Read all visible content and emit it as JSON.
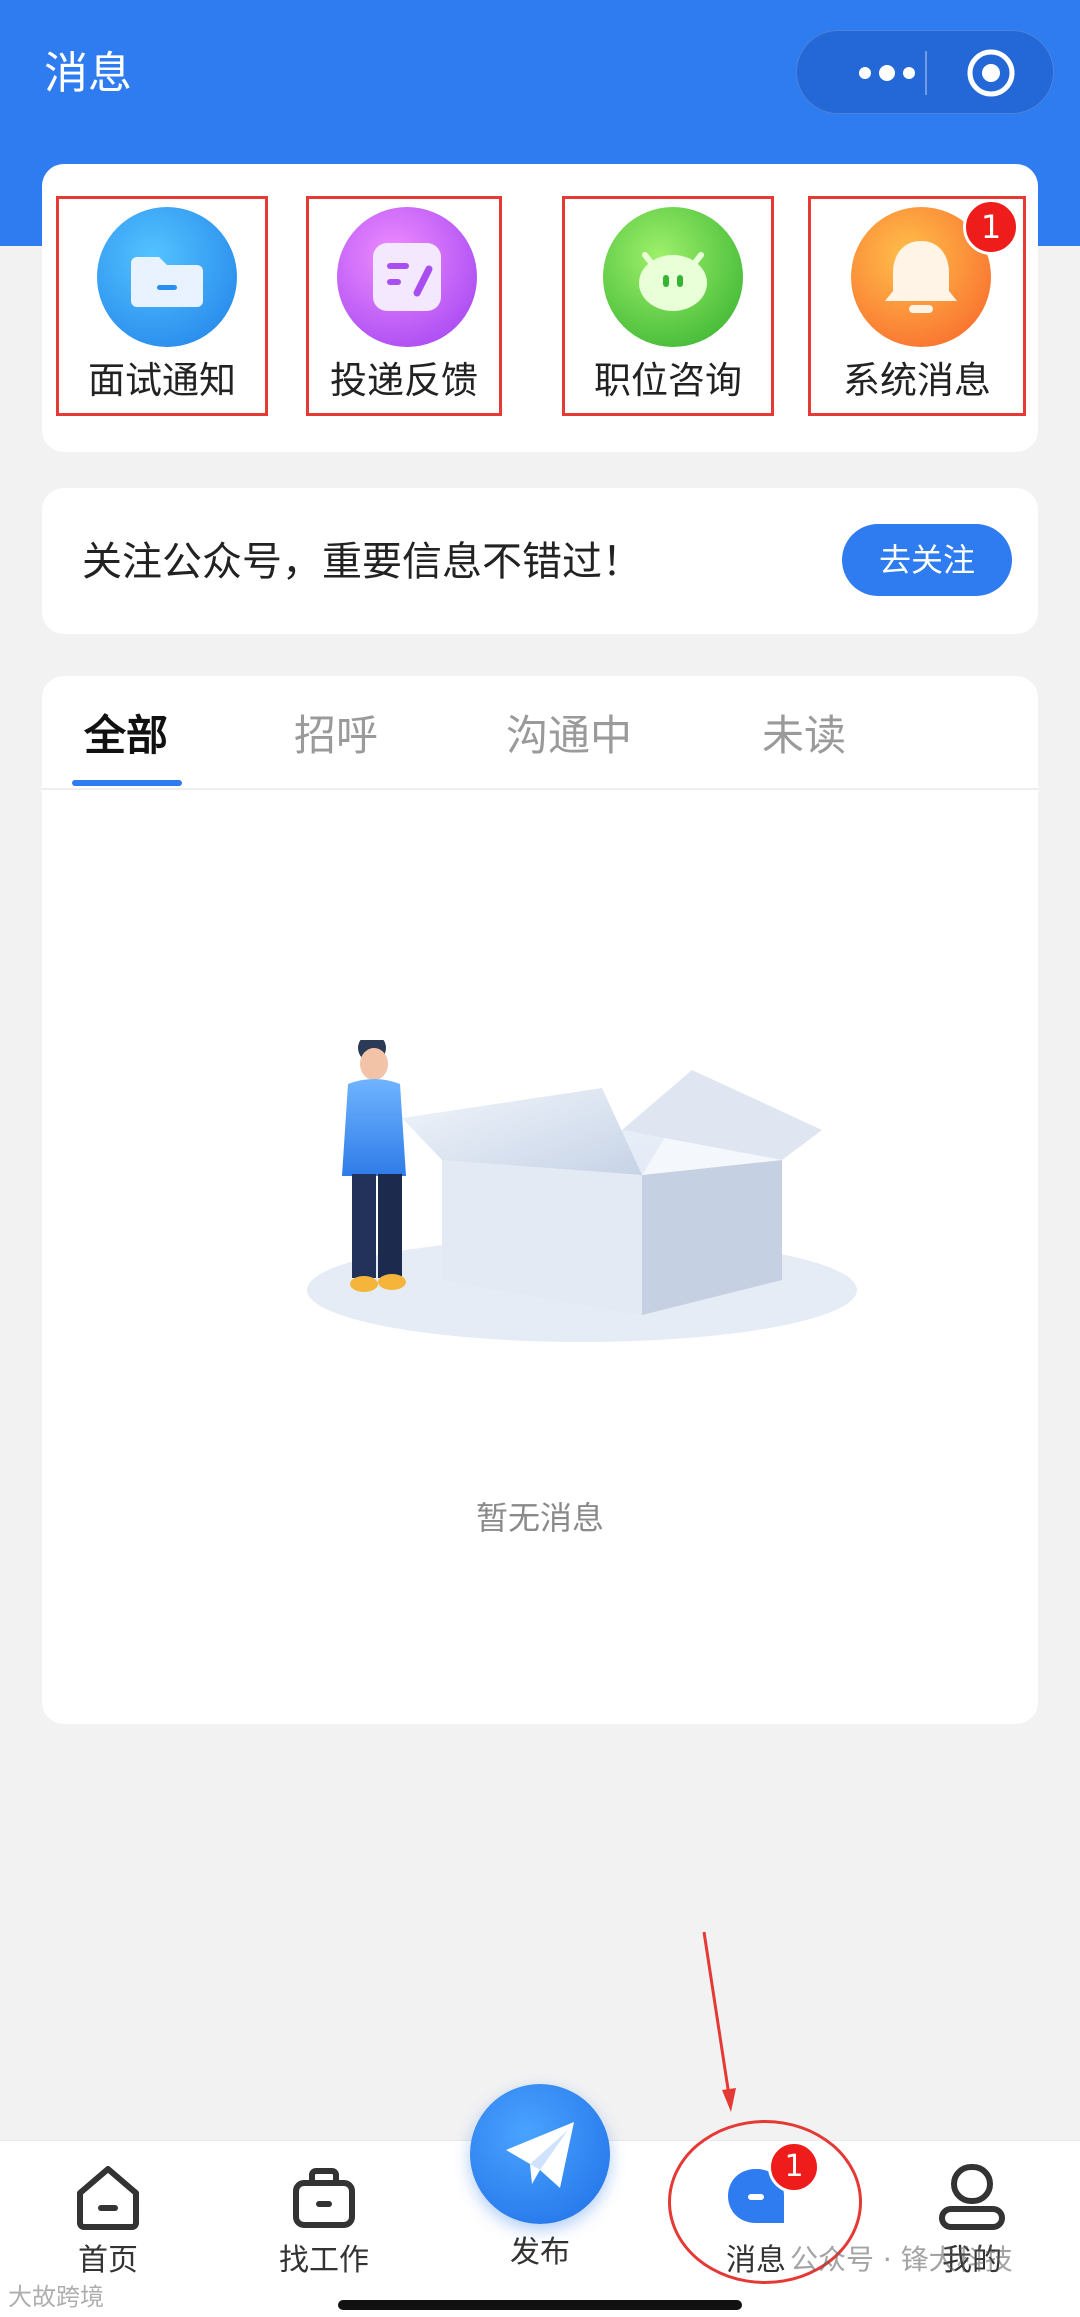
{
  "header": {
    "title": "消息"
  },
  "shortcuts": [
    {
      "label": "面试通知",
      "icon": "folder-icon",
      "color": "#2a8ef0"
    },
    {
      "label": "投递反馈",
      "icon": "edit-note-icon",
      "color": "#b146f0"
    },
    {
      "label": "职位咨询",
      "icon": "chat-face-icon",
      "color": "#4cc43a"
    },
    {
      "label": "系统消息",
      "icon": "bell-icon",
      "color": "#fb7a2e",
      "badge": "1"
    }
  ],
  "follow": {
    "text": "关注公众号，重要信息不错过！",
    "button": "去关注"
  },
  "tabs": [
    {
      "label": "全部",
      "active": true
    },
    {
      "label": "招呼",
      "active": false
    },
    {
      "label": "沟通中",
      "active": false
    },
    {
      "label": "未读",
      "active": false
    }
  ],
  "empty": {
    "text": "暂无消息"
  },
  "tabbar": [
    {
      "label": "首页",
      "icon": "home-icon"
    },
    {
      "label": "找工作",
      "icon": "briefcase-icon"
    },
    {
      "label": "发布",
      "icon": "paper-plane-icon"
    },
    {
      "label": "消息",
      "icon": "message-icon",
      "badge": "1"
    },
    {
      "label": "我的",
      "icon": "profile-icon"
    }
  ],
  "watermarks": {
    "right": "公众号 · 锋犬科技",
    "left": "大故跨境"
  },
  "colors": {
    "primary": "#2f7cf0",
    "badge": "#ef1c1c",
    "annotation": "#e53935"
  }
}
